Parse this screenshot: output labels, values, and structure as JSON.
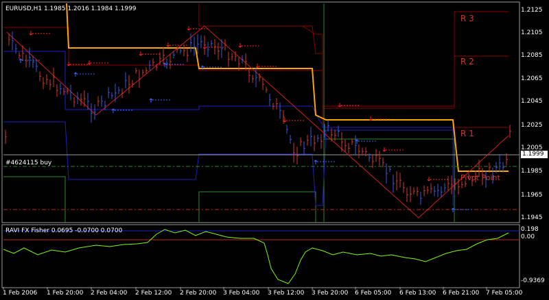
{
  "chart_header": "EURUSD,H1  1.1985 1.2016 1.1984 1.1999",
  "order_label": "#4624115 buy",
  "indicator_header": "RAVI FX Fisher 0.0695 -0.0700 0.0700",
  "current_price": "1.1999",
  "price_axis": [
    "1.2125",
    "1.2105",
    "1.2085",
    "1.2065",
    "1.2045",
    "1.2025",
    "1.2005",
    "1.1985",
    "1.1965",
    "1.1945"
  ],
  "indicator_axis": [
    "0.198",
    "0.00",
    "-0.9369"
  ],
  "time_axis": [
    "1 Feb 2006",
    "1 Feb 20:00",
    "2 Feb 04:00",
    "2 Feb 12:00",
    "2 Feb 20:00",
    "3 Feb 04:00",
    "3 Feb 12:00",
    "3 Feb 20:00",
    "6 Feb 05:00",
    "6 Feb 13:00",
    "6 Feb 21:00",
    "7 Feb 05:00"
  ],
  "levels": {
    "r3": "R 3",
    "r2": "R 2",
    "r1": "R 1",
    "pivot": "Pivot Point"
  },
  "colors": {
    "background": "#000000",
    "candle": "#d23a2a",
    "candle_up": "#3a5adc",
    "pivot": "#ffa500",
    "resistance": "#8b0000",
    "support": "#2a8a2a",
    "band": "#1e1ec8",
    "fisher": "#7cfc00",
    "zigzag": "#d02020"
  }
}
